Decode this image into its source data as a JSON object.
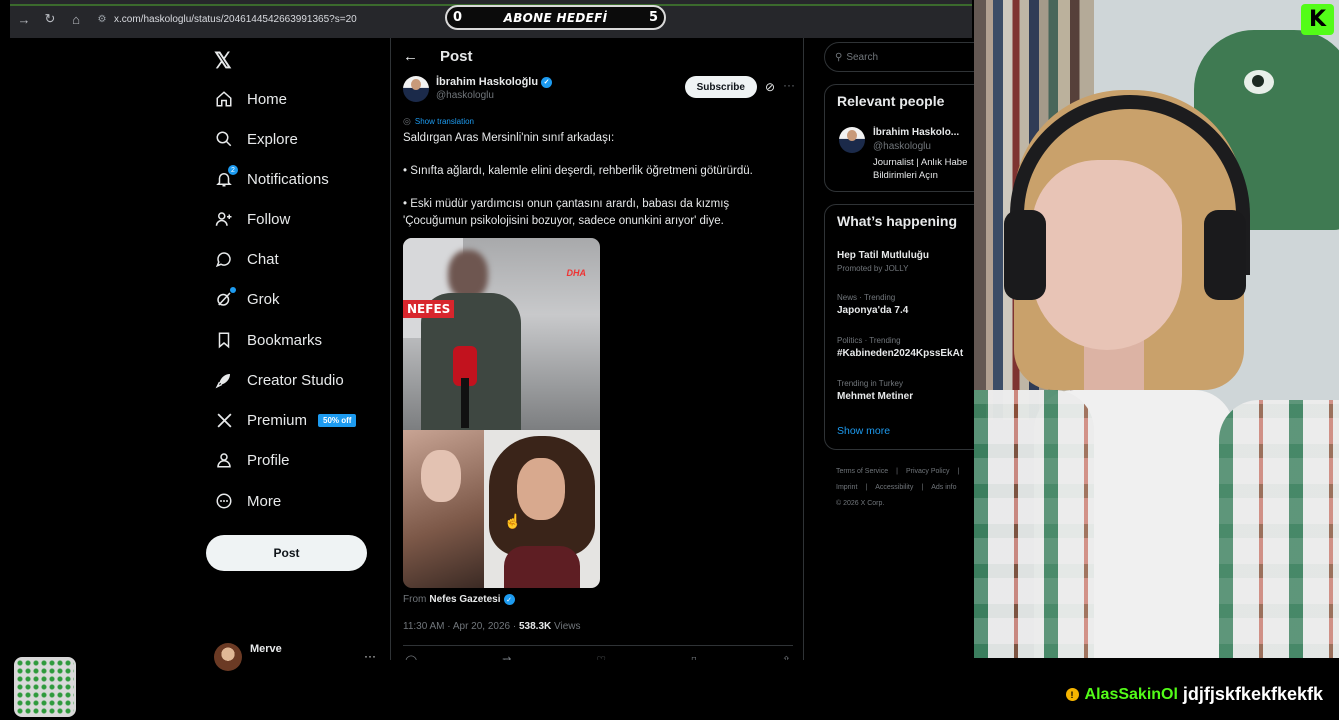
{
  "browser": {
    "url": "x.com/haskologlu/status/2046144542663991365?s=20"
  },
  "stream_goal": {
    "current": "0",
    "label": "ABONE HEDEFİ",
    "target": "5"
  },
  "sidebar": {
    "items": [
      {
        "label": "Home",
        "icon": "home-icon"
      },
      {
        "label": "Explore",
        "icon": "search-icon"
      },
      {
        "label": "Notifications",
        "icon": "bell-icon",
        "badge": "2"
      },
      {
        "label": "Follow",
        "icon": "person-plus-icon"
      },
      {
        "label": "Chat",
        "icon": "chat-bubble-icon"
      },
      {
        "label": "Grok",
        "icon": "grok-icon"
      },
      {
        "label": "Bookmarks",
        "icon": "bookmark-icon"
      },
      {
        "label": "Creator Studio",
        "icon": "rocket-icon"
      },
      {
        "label": "Premium",
        "icon": "x-logo-icon",
        "promo": "50% off"
      },
      {
        "label": "Profile",
        "icon": "person-icon"
      },
      {
        "label": "More",
        "icon": "more-circle-icon"
      }
    ],
    "post_button": "Post",
    "account_name": "Merve",
    "account_more": "···"
  },
  "post": {
    "header_title": "Post",
    "author_name": "İbrahim Haskoloğlu",
    "author_handle": "@haskologlu",
    "subscribe_label": "Subscribe",
    "show_translation": "Show translation",
    "text_lines": [
      "Saldırgan Aras Mersinli'nin sınıf arkadaşı:",
      "",
      "• Sınıfta ağlardı, kalemle elini deşerdi, rehberlik öğretmeni götürürdü.",
      "",
      "• Eski müdür yardımcısı onun çantasını arardı, babası da kızmış",
      "'Çocuğumun psikolojisini bozuyor, sadece onunkini arıyor' diye."
    ],
    "media_overlay": {
      "brand": "NEFES",
      "agency": "DHA"
    },
    "from_label": "From",
    "from_source": "Nefes Gazetesi",
    "timestamp": "11:30 AM · Apr 20, 2026 · ",
    "views_count": "538.3K",
    "views_label": " Views"
  },
  "right_column": {
    "search_placeholder": "Search",
    "relevant_people_title": "Relevant people",
    "relevant_person": {
      "name": "İbrahim Haskolo...",
      "handle": "@haskologlu",
      "bio_line1": "Journalist | Anlık Habe",
      "bio_line2": "Bildirimleri Açın"
    },
    "whats_happening_title": "What’s happening",
    "trends": [
      {
        "category": "",
        "title": "Hep Tatil Mutluluğu",
        "promoted": "Promoted by JOLLY"
      },
      {
        "category": "News · Trending",
        "title": "Japonya'da 7.4"
      },
      {
        "category": "Politics · Trending",
        "title": "#Kabineden2024KpssEkAt"
      },
      {
        "category": "Trending in Turkey",
        "title": "Mehmet Metiner"
      }
    ],
    "show_more": "Show more",
    "footer": [
      "Terms of Service",
      "|",
      "Privacy Policy",
      "|",
      "Imprint",
      "|",
      "Accessibility",
      "|",
      "Ads info",
      "© 2026 X Corp."
    ]
  },
  "stream_overlay": {
    "platform_logo": "K",
    "chat_user": "AlasSakinOl",
    "chat_message": "jdjfjskfkekfkekfk"
  },
  "colors": {
    "accent": "#1d9bf0",
    "kick_green": "#53fc18",
    "background": "#000000"
  }
}
